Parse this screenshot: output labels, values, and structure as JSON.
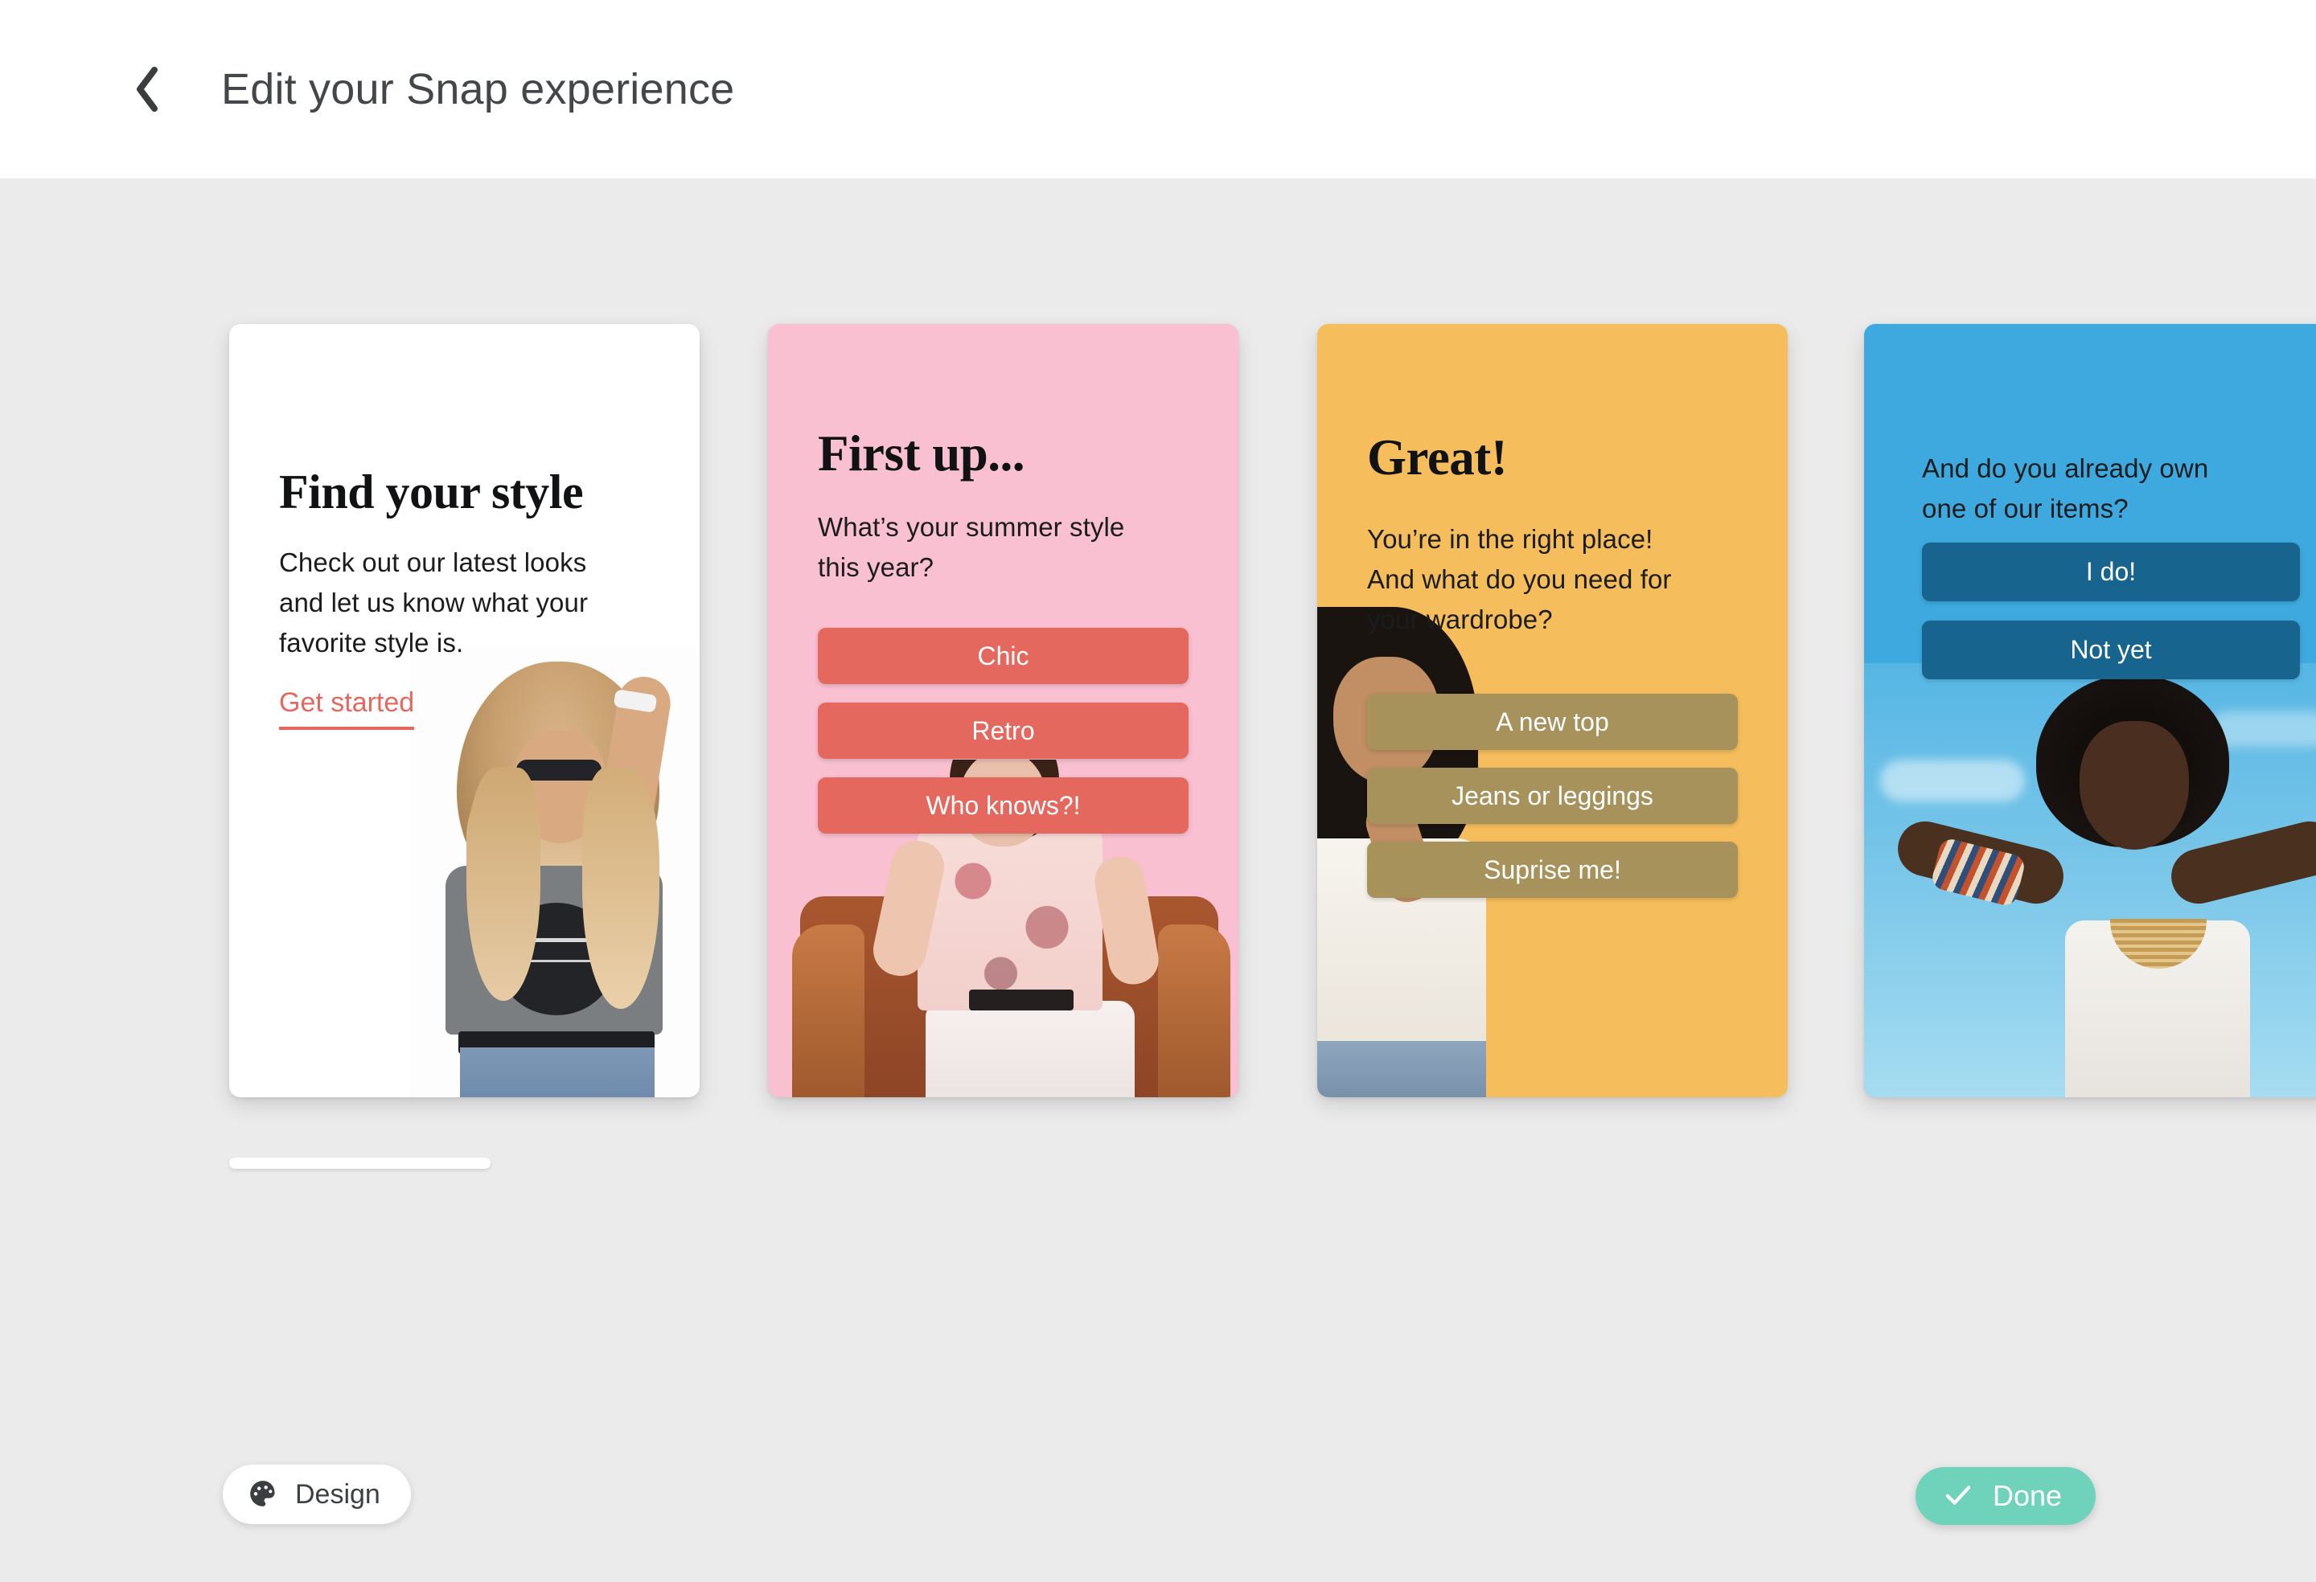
{
  "header": {
    "back_icon": "chevron-left-icon",
    "title": "Edit your Snap experience"
  },
  "cards": [
    {
      "id": "card-1",
      "background": "#ffffff",
      "headline": "Find your style",
      "body": "Check out our latest looks and let us know what your favorite style is.",
      "cta": "Get started",
      "cta_color": "#e5685f",
      "photo": "blonde-model-grey-tee"
    },
    {
      "id": "card-2",
      "background": "#f9c0d2",
      "headline": "First up...",
      "body": "What’s your summer style this year?",
      "button_color": "#e5685f",
      "choices": [
        "Chic",
        "Retro",
        "Who knows?!"
      ],
      "photo": "model-floral-blouse-leather-chair"
    },
    {
      "id": "card-3",
      "background": "#f5bd5c",
      "headline": "Great!",
      "body": "You’re in the right place! And what do you need for your wardrobe?",
      "button_color": "#a8925c",
      "choices": [
        "A new top",
        "Jeans or leggings",
        "Suprise me!"
      ],
      "photo": "model-white-top-thinking"
    },
    {
      "id": "card-4",
      "background": "#3ea9de",
      "headline": "",
      "body": "And do you already own one of our items?",
      "button_color": "#17658f",
      "choices": [
        "I do!",
        "Not yet"
      ],
      "photo": "model-blue-sky-arms-up"
    }
  ],
  "toolbar": {
    "design_label": "Design",
    "design_icon": "palette-icon",
    "done_label": "Done",
    "done_icon": "check-icon",
    "done_color": "#6fd3bb"
  },
  "scroll": {
    "indicator": "carousel-scroll-thumb"
  }
}
